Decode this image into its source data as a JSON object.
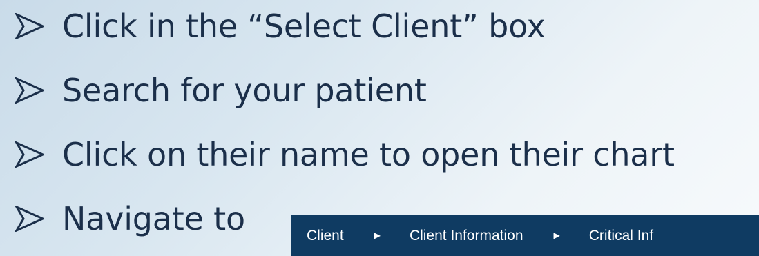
{
  "bullets": [
    {
      "text": "Click in the “Select Client” box",
      "icon": "arrow-bullet-icon"
    },
    {
      "text": "Search for your patient",
      "icon": "arrow-bullet-icon"
    },
    {
      "text": "Click on their name to open their chart",
      "icon": "arrow-bullet-icon"
    },
    {
      "text": "Navigate to",
      "icon": "arrow-bullet-icon"
    }
  ],
  "navigation": {
    "items": [
      {
        "label": "Client"
      },
      {
        "label": "Client Information"
      },
      {
        "label": "Critical Inf"
      }
    ],
    "separator_icon": "chevron-right-icon",
    "background": "#0f3b62",
    "text_color": "#ffffff"
  }
}
